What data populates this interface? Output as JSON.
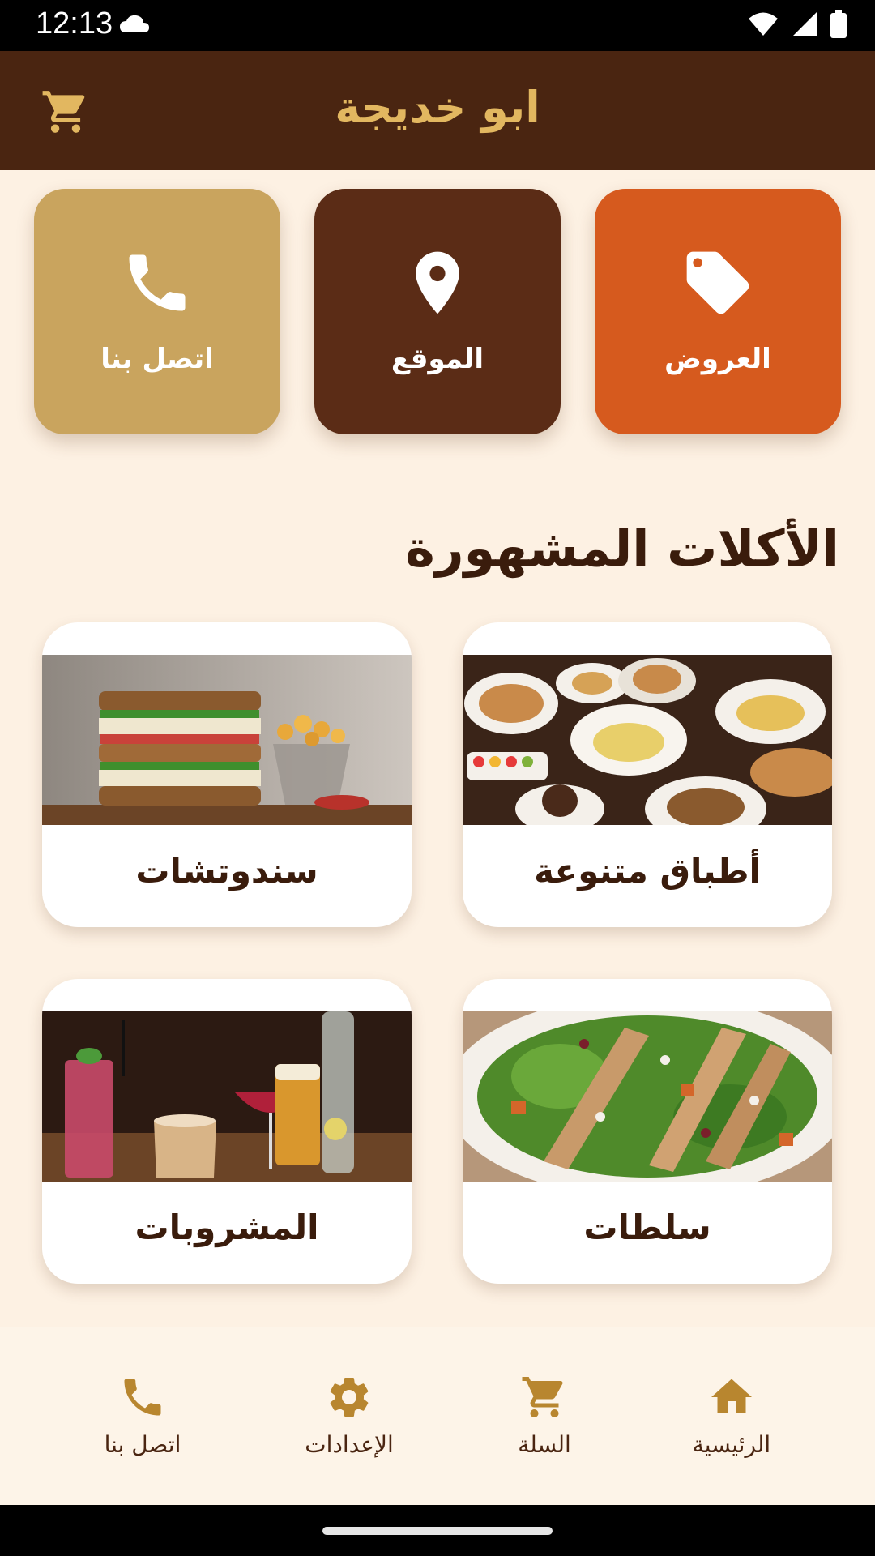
{
  "status_bar": {
    "time": "12:13"
  },
  "app_bar": {
    "title": "ابو خديجة"
  },
  "quick_actions": [
    {
      "label": "اتصل بنا",
      "icon": "phone-icon",
      "color": "#c9a45e"
    },
    {
      "label": "الموقع",
      "icon": "location-pin-icon",
      "color": "#5b2c16"
    },
    {
      "label": "العروض",
      "icon": "tag-icon",
      "color": "#d65a1e"
    }
  ],
  "section": {
    "title": "الأكلات المشهورة"
  },
  "categories": [
    {
      "label": "سندوتشات",
      "image": "sandwich-image"
    },
    {
      "label": "أطباق متنوعة",
      "image": "assorted-dishes-image"
    },
    {
      "label": "المشروبات",
      "image": "drinks-image"
    },
    {
      "label": "سلطات",
      "image": "salad-image"
    }
  ],
  "bottom_nav": [
    {
      "label": "اتصل بنا",
      "icon": "phone-icon"
    },
    {
      "label": "الإعدادات",
      "icon": "gear-icon"
    },
    {
      "label": "السلة",
      "icon": "cart-icon"
    },
    {
      "label": "الرئيسية",
      "icon": "home-icon"
    }
  ],
  "colors": {
    "primary_brown": "#4a2511",
    "gold": "#e2b760",
    "background": "#fdf1e3",
    "nav_icon": "#b8862f"
  }
}
